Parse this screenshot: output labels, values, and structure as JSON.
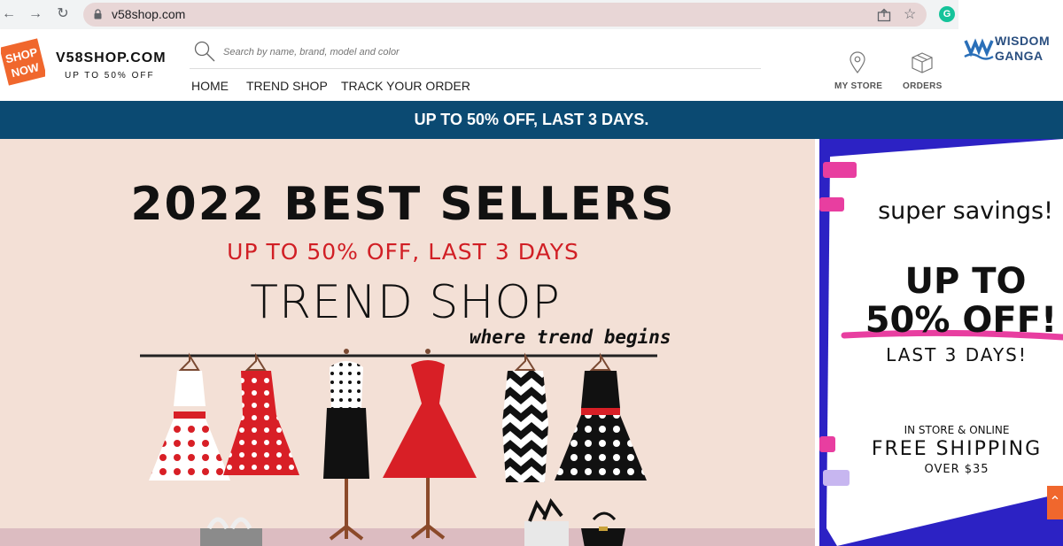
{
  "browser": {
    "url": "v58shop.com",
    "back_icon": "arrow-left-icon",
    "forward_icon": "arrow-right-icon",
    "reload_icon": "reload-icon",
    "extension_letter": "G"
  },
  "header": {
    "badge_text_1": "SHOP",
    "badge_text_2": "NOW",
    "site_name": "V58SHOP.COM",
    "tagline": "UP TO 50% OFF",
    "search_placeholder": "Search by name, brand, model and color",
    "nav": [
      {
        "label": "HOME"
      },
      {
        "label": "TREND SHOP"
      },
      {
        "label": "TRACK YOUR ORDER"
      }
    ],
    "my_store_label": "MY STORE",
    "orders_label": "ORDERS"
  },
  "watermark": {
    "line1": "WISDOM",
    "line2": "GANGA"
  },
  "promo_strip": "UP TO 50% OFF, LAST 3 DAYS.",
  "hero": {
    "title": "2022 BEST SELLERS",
    "subtitle": "UP TO 50% OFF, LAST 3 DAYS",
    "brand": "TREND SHOP",
    "slogan": "where trend begins"
  },
  "side_ad": {
    "headline": "super savings!",
    "offer_1": "UP TO",
    "offer_2": "50% OFF!",
    "duration": "LAST 3 DAYS!",
    "channel": "IN STORE & ONLINE",
    "shipping": "FREE SHIPPING",
    "threshold": "OVER $35"
  },
  "colors": {
    "promo_bg": "#0b4a72",
    "accent_red": "#d11f25",
    "badge_orange": "#f0672d",
    "side_blue": "#2c22c4",
    "highlight_pink": "#e83ea0"
  }
}
